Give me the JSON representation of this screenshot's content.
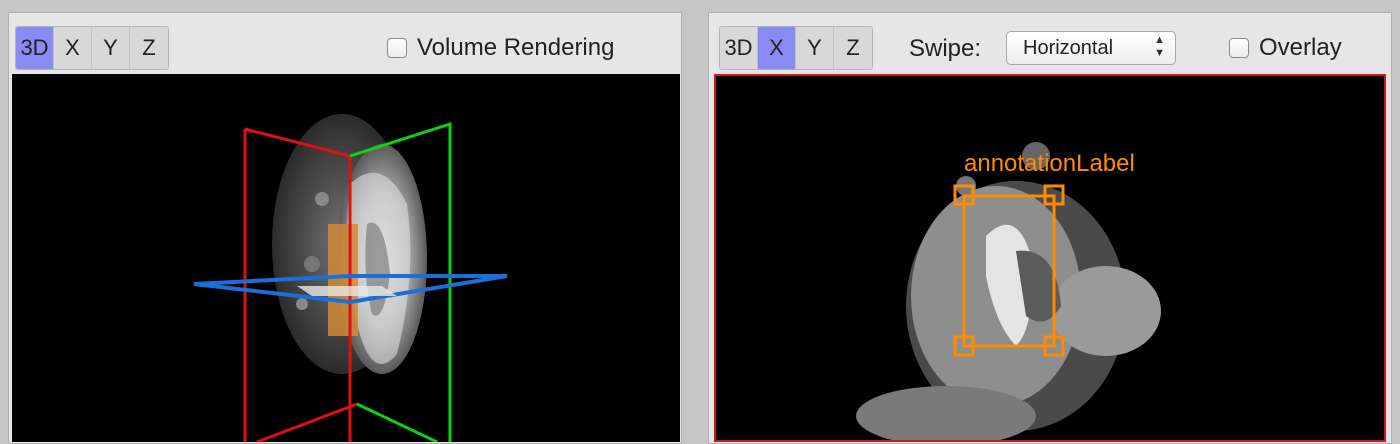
{
  "left_panel": {
    "view_buttons": [
      "3D",
      "X",
      "Y",
      "Z"
    ],
    "active_view": "3D",
    "volume_rendering_label": "Volume Rendering",
    "volume_rendering_checked": false
  },
  "right_panel": {
    "view_buttons": [
      "3D",
      "X",
      "Y",
      "Z"
    ],
    "active_view": "X",
    "swipe_label": "Swipe:",
    "swipe_value": "Horizontal",
    "overlay_label": "Overlay",
    "overlay_checked": false,
    "annotation_label": "annotationLabel"
  },
  "colors": {
    "active_button": "#8a8af5",
    "plane_red": "#e01010",
    "plane_green": "#10d010",
    "plane_blue": "#1a6fd8",
    "annotation": "#ff8c00"
  }
}
